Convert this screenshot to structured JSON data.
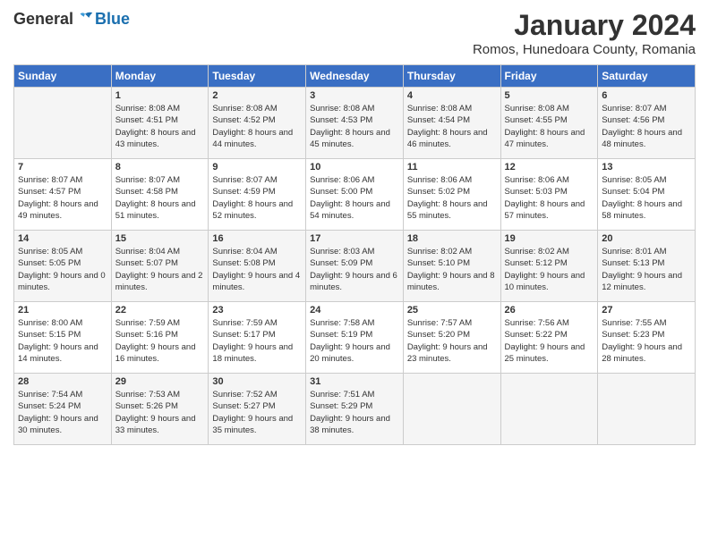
{
  "logo": {
    "general": "General",
    "blue": "Blue"
  },
  "title": "January 2024",
  "subtitle": "Romos, Hunedoara County, Romania",
  "headers": [
    "Sunday",
    "Monday",
    "Tuesday",
    "Wednesday",
    "Thursday",
    "Friday",
    "Saturday"
  ],
  "weeks": [
    [
      {
        "day": "",
        "sunrise": "",
        "sunset": "",
        "daylight": ""
      },
      {
        "day": "1",
        "sunrise": "Sunrise: 8:08 AM",
        "sunset": "Sunset: 4:51 PM",
        "daylight": "Daylight: 8 hours and 43 minutes."
      },
      {
        "day": "2",
        "sunrise": "Sunrise: 8:08 AM",
        "sunset": "Sunset: 4:52 PM",
        "daylight": "Daylight: 8 hours and 44 minutes."
      },
      {
        "day": "3",
        "sunrise": "Sunrise: 8:08 AM",
        "sunset": "Sunset: 4:53 PM",
        "daylight": "Daylight: 8 hours and 45 minutes."
      },
      {
        "day": "4",
        "sunrise": "Sunrise: 8:08 AM",
        "sunset": "Sunset: 4:54 PM",
        "daylight": "Daylight: 8 hours and 46 minutes."
      },
      {
        "day": "5",
        "sunrise": "Sunrise: 8:08 AM",
        "sunset": "Sunset: 4:55 PM",
        "daylight": "Daylight: 8 hours and 47 minutes."
      },
      {
        "day": "6",
        "sunrise": "Sunrise: 8:07 AM",
        "sunset": "Sunset: 4:56 PM",
        "daylight": "Daylight: 8 hours and 48 minutes."
      }
    ],
    [
      {
        "day": "7",
        "sunrise": "Sunrise: 8:07 AM",
        "sunset": "Sunset: 4:57 PM",
        "daylight": "Daylight: 8 hours and 49 minutes."
      },
      {
        "day": "8",
        "sunrise": "Sunrise: 8:07 AM",
        "sunset": "Sunset: 4:58 PM",
        "daylight": "Daylight: 8 hours and 51 minutes."
      },
      {
        "day": "9",
        "sunrise": "Sunrise: 8:07 AM",
        "sunset": "Sunset: 4:59 PM",
        "daylight": "Daylight: 8 hours and 52 minutes."
      },
      {
        "day": "10",
        "sunrise": "Sunrise: 8:06 AM",
        "sunset": "Sunset: 5:00 PM",
        "daylight": "Daylight: 8 hours and 54 minutes."
      },
      {
        "day": "11",
        "sunrise": "Sunrise: 8:06 AM",
        "sunset": "Sunset: 5:02 PM",
        "daylight": "Daylight: 8 hours and 55 minutes."
      },
      {
        "day": "12",
        "sunrise": "Sunrise: 8:06 AM",
        "sunset": "Sunset: 5:03 PM",
        "daylight": "Daylight: 8 hours and 57 minutes."
      },
      {
        "day": "13",
        "sunrise": "Sunrise: 8:05 AM",
        "sunset": "Sunset: 5:04 PM",
        "daylight": "Daylight: 8 hours and 58 minutes."
      }
    ],
    [
      {
        "day": "14",
        "sunrise": "Sunrise: 8:05 AM",
        "sunset": "Sunset: 5:05 PM",
        "daylight": "Daylight: 9 hours and 0 minutes."
      },
      {
        "day": "15",
        "sunrise": "Sunrise: 8:04 AM",
        "sunset": "Sunset: 5:07 PM",
        "daylight": "Daylight: 9 hours and 2 minutes."
      },
      {
        "day": "16",
        "sunrise": "Sunrise: 8:04 AM",
        "sunset": "Sunset: 5:08 PM",
        "daylight": "Daylight: 9 hours and 4 minutes."
      },
      {
        "day": "17",
        "sunrise": "Sunrise: 8:03 AM",
        "sunset": "Sunset: 5:09 PM",
        "daylight": "Daylight: 9 hours and 6 minutes."
      },
      {
        "day": "18",
        "sunrise": "Sunrise: 8:02 AM",
        "sunset": "Sunset: 5:10 PM",
        "daylight": "Daylight: 9 hours and 8 minutes."
      },
      {
        "day": "19",
        "sunrise": "Sunrise: 8:02 AM",
        "sunset": "Sunset: 5:12 PM",
        "daylight": "Daylight: 9 hours and 10 minutes."
      },
      {
        "day": "20",
        "sunrise": "Sunrise: 8:01 AM",
        "sunset": "Sunset: 5:13 PM",
        "daylight": "Daylight: 9 hours and 12 minutes."
      }
    ],
    [
      {
        "day": "21",
        "sunrise": "Sunrise: 8:00 AM",
        "sunset": "Sunset: 5:15 PM",
        "daylight": "Daylight: 9 hours and 14 minutes."
      },
      {
        "day": "22",
        "sunrise": "Sunrise: 7:59 AM",
        "sunset": "Sunset: 5:16 PM",
        "daylight": "Daylight: 9 hours and 16 minutes."
      },
      {
        "day": "23",
        "sunrise": "Sunrise: 7:59 AM",
        "sunset": "Sunset: 5:17 PM",
        "daylight": "Daylight: 9 hours and 18 minutes."
      },
      {
        "day": "24",
        "sunrise": "Sunrise: 7:58 AM",
        "sunset": "Sunset: 5:19 PM",
        "daylight": "Daylight: 9 hours and 20 minutes."
      },
      {
        "day": "25",
        "sunrise": "Sunrise: 7:57 AM",
        "sunset": "Sunset: 5:20 PM",
        "daylight": "Daylight: 9 hours and 23 minutes."
      },
      {
        "day": "26",
        "sunrise": "Sunrise: 7:56 AM",
        "sunset": "Sunset: 5:22 PM",
        "daylight": "Daylight: 9 hours and 25 minutes."
      },
      {
        "day": "27",
        "sunrise": "Sunrise: 7:55 AM",
        "sunset": "Sunset: 5:23 PM",
        "daylight": "Daylight: 9 hours and 28 minutes."
      }
    ],
    [
      {
        "day": "28",
        "sunrise": "Sunrise: 7:54 AM",
        "sunset": "Sunset: 5:24 PM",
        "daylight": "Daylight: 9 hours and 30 minutes."
      },
      {
        "day": "29",
        "sunrise": "Sunrise: 7:53 AM",
        "sunset": "Sunset: 5:26 PM",
        "daylight": "Daylight: 9 hours and 33 minutes."
      },
      {
        "day": "30",
        "sunrise": "Sunrise: 7:52 AM",
        "sunset": "Sunset: 5:27 PM",
        "daylight": "Daylight: 9 hours and 35 minutes."
      },
      {
        "day": "31",
        "sunrise": "Sunrise: 7:51 AM",
        "sunset": "Sunset: 5:29 PM",
        "daylight": "Daylight: 9 hours and 38 minutes."
      },
      {
        "day": "",
        "sunrise": "",
        "sunset": "",
        "daylight": ""
      },
      {
        "day": "",
        "sunrise": "",
        "sunset": "",
        "daylight": ""
      },
      {
        "day": "",
        "sunrise": "",
        "sunset": "",
        "daylight": ""
      }
    ]
  ]
}
